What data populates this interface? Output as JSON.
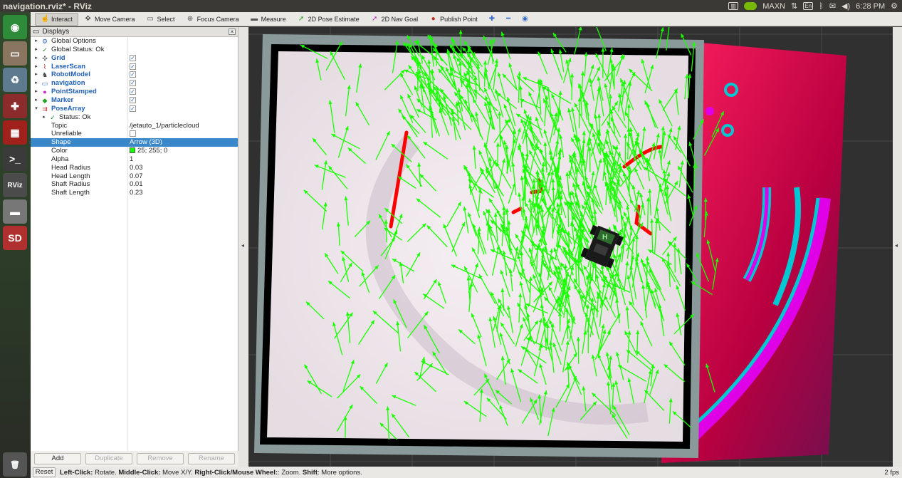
{
  "window": {
    "title": "navigation.rviz* - RViz"
  },
  "tray": {
    "display_label": "MAXN",
    "keyboard": "En",
    "time": "6:28 PM"
  },
  "launcher": {
    "items": [
      {
        "name": "ubuntu-home-icon",
        "glyph": "◉",
        "color": "#2e8b3a"
      },
      {
        "name": "files-icon",
        "glyph": "▭",
        "color": "#8a7560"
      },
      {
        "name": "trash-manager-icon",
        "glyph": "♻",
        "color": "#5d7a8e"
      },
      {
        "name": "settings-icon",
        "glyph": "✚",
        "color": "#8b2b2b"
      },
      {
        "name": "system-monitor-icon",
        "glyph": "▦",
        "color": "#a0201c"
      },
      {
        "name": "terminal-icon",
        "glyph": ">_",
        "color": "#3b3b3b"
      },
      {
        "name": "rviz-icon",
        "glyph": "RViz",
        "color": "#4b4b4b"
      },
      {
        "name": "drive-icon",
        "glyph": "▬",
        "color": "#777"
      },
      {
        "name": "sd-card-icon",
        "glyph": "SD",
        "color": "#b03030"
      }
    ]
  },
  "toolbar": {
    "tools": [
      {
        "label": "Interact",
        "icon": "hand-icon",
        "glyph": "☝",
        "active": true
      },
      {
        "label": "Move Camera",
        "icon": "move-camera-icon",
        "glyph": "✥"
      },
      {
        "label": "Select",
        "icon": "select-icon",
        "glyph": "▭"
      },
      {
        "label": "Focus Camera",
        "icon": "focus-camera-icon",
        "glyph": "⊕"
      },
      {
        "label": "Measure",
        "icon": "ruler-icon",
        "glyph": "▬"
      },
      {
        "label": "2D Pose Estimate",
        "icon": "pose-estimate-icon",
        "glyph": "➚"
      },
      {
        "label": "2D Nav Goal",
        "icon": "nav-goal-icon",
        "glyph": "➚"
      },
      {
        "label": "Publish Point",
        "icon": "publish-point-icon",
        "glyph": "●"
      }
    ],
    "extra_icons": [
      "plus-icon",
      "minus-icon",
      "eye-icon"
    ]
  },
  "displays_panel": {
    "title": "Displays",
    "rows": [
      {
        "label": "Global Options",
        "icon": "gear-icon",
        "glyph": "⚙",
        "arrow": "▸",
        "indent": 0
      },
      {
        "label": "Global Status: Ok",
        "icon": "check-icon",
        "glyph": "✓",
        "arrow": "▸",
        "indent": 0
      },
      {
        "label": "Grid",
        "icon": "grid-icon",
        "glyph": "✣",
        "arrow": "▸",
        "indent": 0,
        "blue": true,
        "checked": true
      },
      {
        "label": "LaserScan",
        "icon": "laserscan-icon",
        "glyph": "⌇",
        "arrow": "▸",
        "indent": 0,
        "blue": true,
        "checked": true
      },
      {
        "label": "RobotModel",
        "icon": "robot-icon",
        "glyph": "♞",
        "arrow": "▸",
        "indent": 0,
        "blue": true,
        "checked": true
      },
      {
        "label": "navigation",
        "icon": "folder-icon",
        "glyph": "▭",
        "arrow": "▸",
        "indent": 0,
        "blue": true,
        "checked": true
      },
      {
        "label": "PointStamped",
        "icon": "point-icon",
        "glyph": "●",
        "arrow": "▸",
        "indent": 0,
        "blue": true,
        "checked": true
      },
      {
        "label": "Marker",
        "icon": "marker-icon",
        "glyph": "◆",
        "arrow": "▸",
        "indent": 0,
        "blue": true,
        "checked": true
      },
      {
        "label": "PoseArray",
        "icon": "posearray-icon",
        "glyph": "⇉",
        "arrow": "▾",
        "indent": 0,
        "blue": true,
        "checked": true
      },
      {
        "label": "Status: Ok",
        "icon": "check-icon",
        "glyph": "✓",
        "arrow": "▸",
        "indent": 1
      },
      {
        "label": "Topic",
        "value": "/jetauto_1/particlecloud",
        "indent": 2
      },
      {
        "label": "Unreliable",
        "indent": 2,
        "checkbox_empty": true
      },
      {
        "label": "Shape",
        "value": "Arrow (3D)",
        "indent": 2,
        "selected": true
      },
      {
        "label": "Color",
        "value": "25; 255; 0",
        "indent": 2,
        "swatch": "#19ff00"
      },
      {
        "label": "Alpha",
        "value": "1",
        "indent": 2
      },
      {
        "label": "Head Radius",
        "value": "0.03",
        "indent": 2
      },
      {
        "label": "Head Length",
        "value": "0.07",
        "indent": 2
      },
      {
        "label": "Shaft Radius",
        "value": "0.01",
        "indent": 2
      },
      {
        "label": "Shaft Length",
        "value": "0.23",
        "indent": 2
      }
    ],
    "buttons": [
      {
        "label": "Add",
        "enabled": true
      },
      {
        "label": "Duplicate",
        "enabled": false
      },
      {
        "label": "Remove",
        "enabled": false
      },
      {
        "label": "Rename",
        "enabled": false
      }
    ]
  },
  "viewport": {
    "colors": {
      "background": "#303030",
      "particles": "#19ff00",
      "laser": "#ff0000",
      "costmap_edge": "#00c8d2",
      "costmap_inflation": "#e000e8",
      "costmap_far": "#c80050",
      "walls": "#000000",
      "free_space": "#f0e8ee"
    },
    "robot_label": "H"
  },
  "statusbar": {
    "reset_label": "Reset",
    "hint": {
      "b1": "Left-Click:",
      "t1": " Rotate. ",
      "b2": "Middle-Click:",
      "t2": " Move X/Y. ",
      "b3": "Right-Click/Mouse Wheel:",
      "t3": ": Zoom. ",
      "b4": "Shift",
      "t4": ": More options."
    },
    "fps": "2 fps"
  }
}
